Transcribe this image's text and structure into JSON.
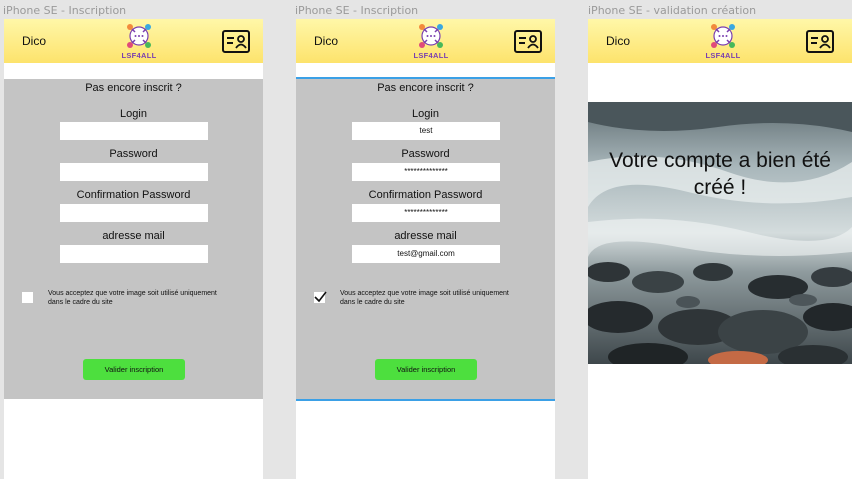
{
  "frames": [
    {
      "title": "iPhone SE - Inscription",
      "header": {
        "menu_label": "Dico",
        "logo_text": "LSF4ALL"
      },
      "form": {
        "title": "Pas encore inscrit ?",
        "login_label": "Login",
        "login_value": "",
        "password_label": "Password",
        "password_value": "",
        "confirm_label": "Confirmation Password",
        "confirm_value": "",
        "email_label": "adresse mail",
        "email_value": "",
        "consent_checked": false,
        "consent_text": "Vous acceptez que votre image soit utilisé uniquement dans le cadre du site",
        "submit_label": "Valider inscription"
      }
    },
    {
      "title": "iPhone SE - Inscription",
      "header": {
        "menu_label": "Dico",
        "logo_text": "LSF4ALL"
      },
      "form": {
        "title": "Pas encore inscrit ?",
        "login_label": "Login",
        "login_value": "test",
        "password_label": "Password",
        "password_value": "**************",
        "confirm_label": "Confirmation Password",
        "confirm_value": "**************",
        "email_label": "adresse mail",
        "email_value": "test@gmail.com",
        "consent_checked": true,
        "consent_text": "Vous acceptez que votre image soit utilisé uniquement dans le cadre du site",
        "submit_label": "Valider inscription"
      }
    },
    {
      "title": "iPhone SE - validation création",
      "header": {
        "menu_label": "Dico",
        "logo_text": "LSF4ALL"
      },
      "confirmation": {
        "message": "Votre compte a bien été créé !"
      }
    }
  ],
  "colors": {
    "header_top": "#fff7a8",
    "header_bottom": "#fde36c",
    "form_bg": "#c4c4c4",
    "button_green": "#4ddf3e",
    "selection_blue": "#3ba0e6",
    "logo_purple": "#7a3fb0"
  },
  "icons": {
    "logo": "lsf4all-logo",
    "profile": "id-card-icon",
    "check": "check-icon"
  }
}
